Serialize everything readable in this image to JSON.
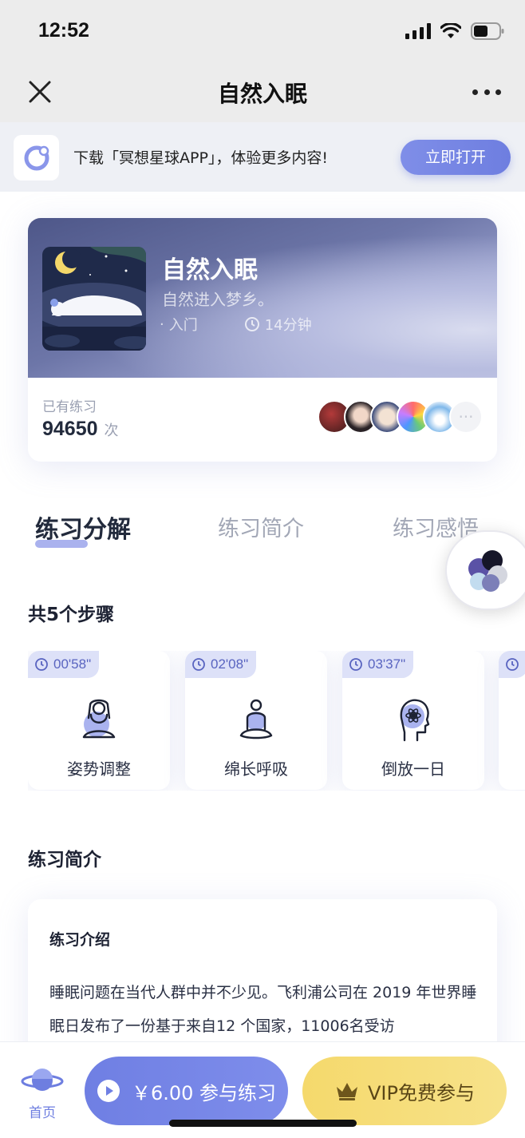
{
  "status": {
    "time": "12:52"
  },
  "nav": {
    "title": "自然入眠"
  },
  "banner": {
    "text": "下载「冥想星球APP」，体验更多内容!",
    "button": "立即打开"
  },
  "course": {
    "title": "自然入眠",
    "subtitle": "自然进入梦乡。",
    "level": "入门",
    "duration": "14分钟",
    "count_label": "已有练习",
    "count": "94650",
    "count_unit": "次"
  },
  "tabs": [
    "练习分解",
    "练习简介",
    "练习感悟"
  ],
  "steps_section": {
    "title": "共5个步骤",
    "steps": [
      {
        "time": "00'58\"",
        "label": "姿势调整"
      },
      {
        "time": "02'08\"",
        "label": "绵长呼吸"
      },
      {
        "time": "03'37\"",
        "label": "倒放一日"
      }
    ]
  },
  "intro_section": {
    "title": "练习简介",
    "heading": "练习介绍",
    "text": "睡眠问题在当代人群中并不少见。飞利浦公司在 2019 年世界睡眠日发布了一份基于来自12 个国家，11006名受访"
  },
  "bottom": {
    "home_label": "首页",
    "buy_label": "￥6.00 参与练习",
    "vip_label": "VIP免费参与"
  },
  "colors": {
    "accent": "#6e7ee0",
    "vip": "#f5d96c"
  }
}
